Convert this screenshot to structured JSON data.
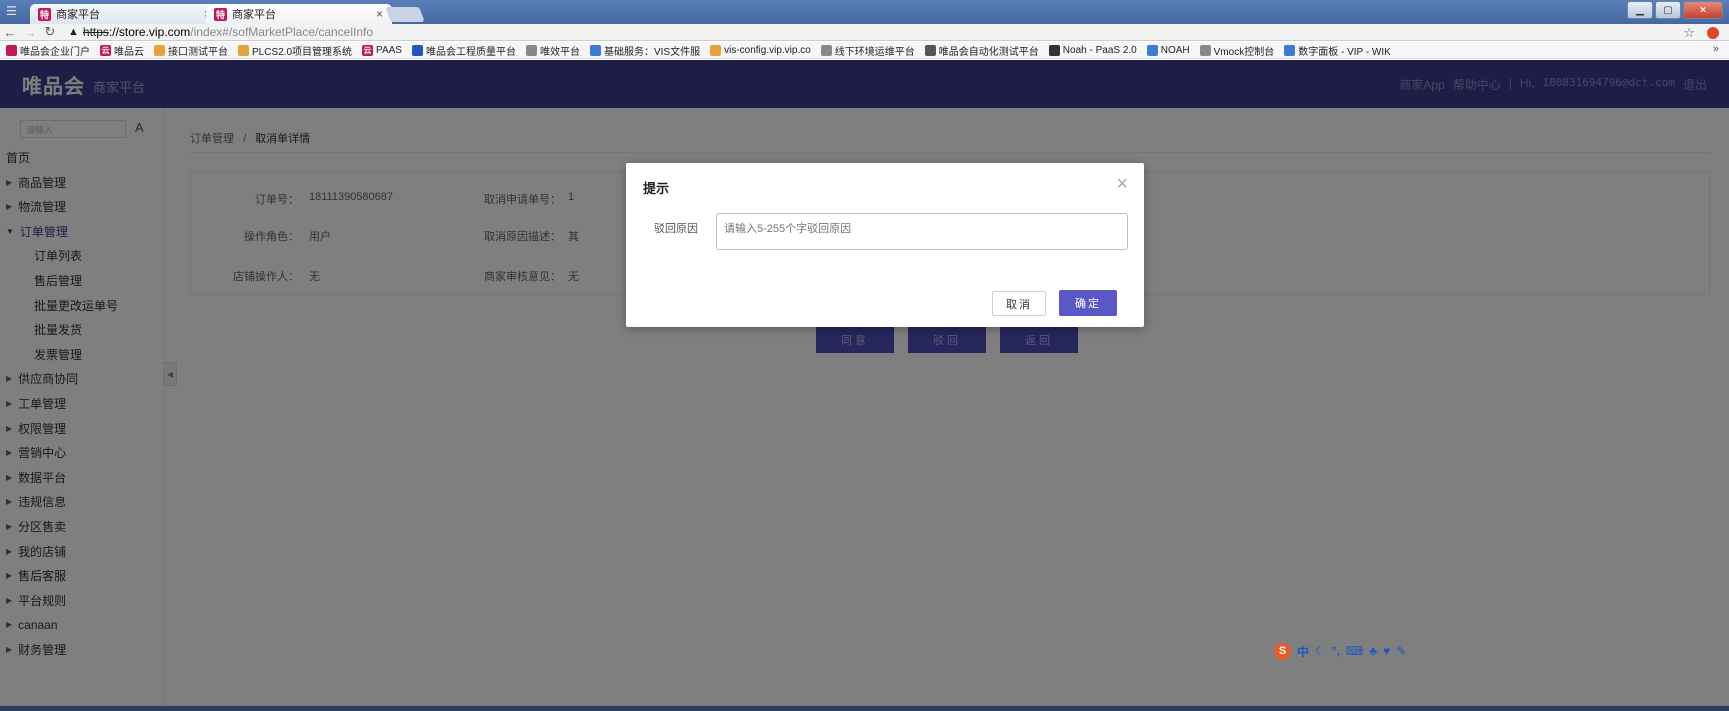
{
  "browser": {
    "tabs": [
      {
        "favicon": "特",
        "title": "商家平台"
      },
      {
        "favicon": "特",
        "title": "商家平台"
      }
    ],
    "url": {
      "proto": "https",
      "host": "://store.vip.com",
      "path": "/index#/sofMarketPlace/cancelInfo"
    },
    "bookmarks": [
      {
        "label": "唯品会企业门户",
        "color": "#c2185b"
      },
      {
        "label": "唯品云",
        "color": "#c2185b",
        "glyph": "云"
      },
      {
        "label": "接口测试平台",
        "color": "#e6a23c"
      },
      {
        "label": "PLCS2.0项目管理系统",
        "color": "#e6a23c"
      },
      {
        "label": "PAAS",
        "color": "#c2185b",
        "glyph": "云"
      },
      {
        "label": "唯品会工程质量平台",
        "color": "#1e58c0"
      },
      {
        "label": "唯效平台",
        "color": "#888888"
      },
      {
        "label": "基础服务：VIS文件服",
        "color": "#3a7bd5"
      },
      {
        "label": "vis-config.vip.vip.co",
        "color": "#e6a23c"
      },
      {
        "label": "线下环境运维平台",
        "color": "#888888"
      },
      {
        "label": "唯品会自动化测试平台",
        "color": "#555555"
      },
      {
        "label": "Noah - PaaS 2.0",
        "color": "#333333"
      },
      {
        "label": "NOAH",
        "color": "#3a7bd5"
      },
      {
        "label": "Vmock控制台",
        "color": "#888888"
      },
      {
        "label": "数字面板 - VIP - WIK",
        "color": "#3a7bd5"
      }
    ],
    "more": "»"
  },
  "header": {
    "logo": "唯品会",
    "subtitle": "商家平台",
    "links": [
      "商家App",
      "帮助中心",
      "|",
      "Hi,",
      "18083169479​6@dct.com",
      "退出"
    ]
  },
  "sidebar": {
    "search_placeholder": "请输入",
    "search_btn": "A",
    "items": [
      {
        "label": "首页",
        "type": "top"
      },
      {
        "label": "商品管理",
        "type": "group"
      },
      {
        "label": "物流管理",
        "type": "group"
      },
      {
        "label": "订单管理",
        "type": "open"
      },
      {
        "label": "订单列表",
        "type": "sub"
      },
      {
        "label": "售后管理",
        "type": "sub"
      },
      {
        "label": "批量更改运单号",
        "type": "sub"
      },
      {
        "label": "批量发货",
        "type": "sub"
      },
      {
        "label": "发票管理",
        "type": "sub"
      },
      {
        "label": "供应商协同",
        "type": "group"
      },
      {
        "label": "工单管理",
        "type": "group"
      },
      {
        "label": "权限管理",
        "type": "group"
      },
      {
        "label": "营销中心",
        "type": "group"
      },
      {
        "label": "数据平台",
        "type": "group"
      },
      {
        "label": "违规信息",
        "type": "group"
      },
      {
        "label": "分区售卖",
        "type": "group"
      },
      {
        "label": "我的店铺",
        "type": "group"
      },
      {
        "label": "售后客服",
        "type": "group"
      },
      {
        "label": "平台规则",
        "type": "group"
      },
      {
        "label": "canaan",
        "type": "group"
      },
      {
        "label": "财务管理",
        "type": "group"
      }
    ]
  },
  "breadcrumb": {
    "parent": "订单管理",
    "sep": "/",
    "current": "取消单详情"
  },
  "info": {
    "order_no_label": "订单号：",
    "order_no": "18111390580687",
    "cancel_req_label": "取消申请单号：",
    "cancel_req": "1",
    "role_label": "操作角色：",
    "role": "用户",
    "reason_desc_label": "取消原因描述：",
    "reason_desc": "其",
    "operator_label": "店铺操作人：",
    "operator": "无",
    "review_label": "商家审核意见：",
    "review": "无"
  },
  "actions": {
    "agree": "同意",
    "reject": "驳回",
    "back": "返回"
  },
  "modal": {
    "title": "提示",
    "close": "×",
    "reason_label": "驳回原因",
    "reason_placeholder": "请输入5-255个字驳回原因",
    "cancel": "取消",
    "ok": "确定"
  },
  "ime": {
    "logo": "S",
    "mode": "中"
  }
}
